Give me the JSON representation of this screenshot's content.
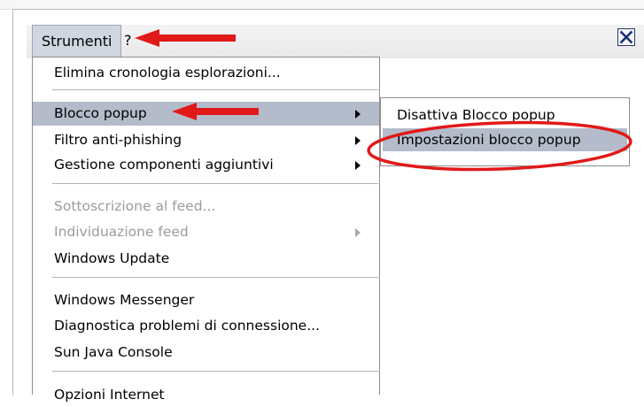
{
  "menubar": {
    "items": [
      {
        "label": "Strumenti"
      },
      {
        "label": "?"
      }
    ]
  },
  "close_icon": "close-x-icon",
  "menu": {
    "items": [
      {
        "label": "Elimina cronologia esplorazioni..."
      },
      {
        "label": "Blocco popup",
        "submenu": true,
        "highlighted": true
      },
      {
        "label": "Filtro anti-phishing",
        "submenu": true
      },
      {
        "label": "Gestione componenti aggiuntivi",
        "submenu": true
      },
      {
        "label": "Sottoscrizione al feed...",
        "disabled": true
      },
      {
        "label": "Individuazione feed",
        "disabled": true,
        "submenu": true
      },
      {
        "label": "Windows Update"
      },
      {
        "label": "Windows Messenger"
      },
      {
        "label": "Diagnostica problemi di connessione..."
      },
      {
        "label": "Sun Java Console"
      },
      {
        "label": "Opzioni Internet"
      }
    ]
  },
  "submenu": {
    "items": [
      {
        "label": "Disattiva Blocco popup"
      },
      {
        "label": "Impostazioni blocco popup",
        "highlighted": true
      }
    ]
  },
  "colors": {
    "highlight": "#b4bccb",
    "annotation_red": "#e11919",
    "disabled_text": "#9b9b9b"
  }
}
